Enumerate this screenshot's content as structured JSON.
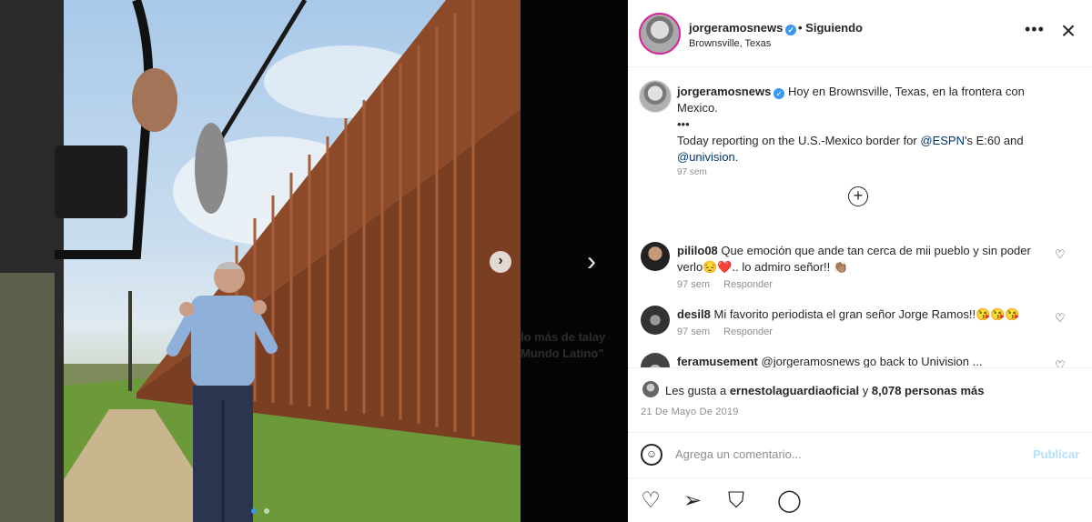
{
  "post": {
    "username": "jorgeramosnews",
    "follow_state": "Siguiendo",
    "location": "Brownsville, Texas",
    "caption_lines": [
      "Hoy en Brownsville, Texas, en la frontera con Mexico.",
      "•••",
      "Today reporting on the U.S.-Mexico border for"
    ],
    "caption_mention_espn": "@ESPN",
    "caption_after_espn": "'s E:60 and",
    "caption_mention_univision": "@univision",
    "caption_end": ".",
    "caption_time": "97 sem",
    "ghost_text": "lo más de talay\nMundo Latino\"",
    "likes_prefix": "Les gusta a ",
    "likes_user": "ernestolaguardiaoficial",
    "likes_mid": " y ",
    "likes_count": "8,078 personas más",
    "date": "21 De Mayo De 2019"
  },
  "comments": [
    {
      "user": "pililo08",
      "text": "Que emoción que ande tan cerca de mii pueblo y sin poder verlo😔❤️.. lo admiro señor!! 👏🏽",
      "time": "97 sem",
      "reply": "Responder"
    },
    {
      "user": "desil8",
      "text": "Mi favorito periodista el gran señor Jorge Ramos!!😘😘😘",
      "time": "97 sem",
      "reply": "Responder"
    },
    {
      "user": "feramusement",
      "text": "@jorgeramosnews go back to Univision ...",
      "time": "",
      "reply": ""
    }
  ],
  "composer": {
    "placeholder": "Agrega un comentario...",
    "post_label": "Publicar"
  },
  "icons": {
    "more": "more-options-icon",
    "close": "close-icon",
    "load_more": "plus-circle-icon",
    "like": "heart-icon",
    "comment": "comment-icon",
    "share": "share-icon",
    "save": "bookmark-icon",
    "emoji": "emoji-icon",
    "next": "chevron-right-icon"
  },
  "colors": {
    "accent_link": "#00376b",
    "verified": "#3897f0",
    "post_disabled": "#b2dffc",
    "wall": "#8a4a2c"
  }
}
